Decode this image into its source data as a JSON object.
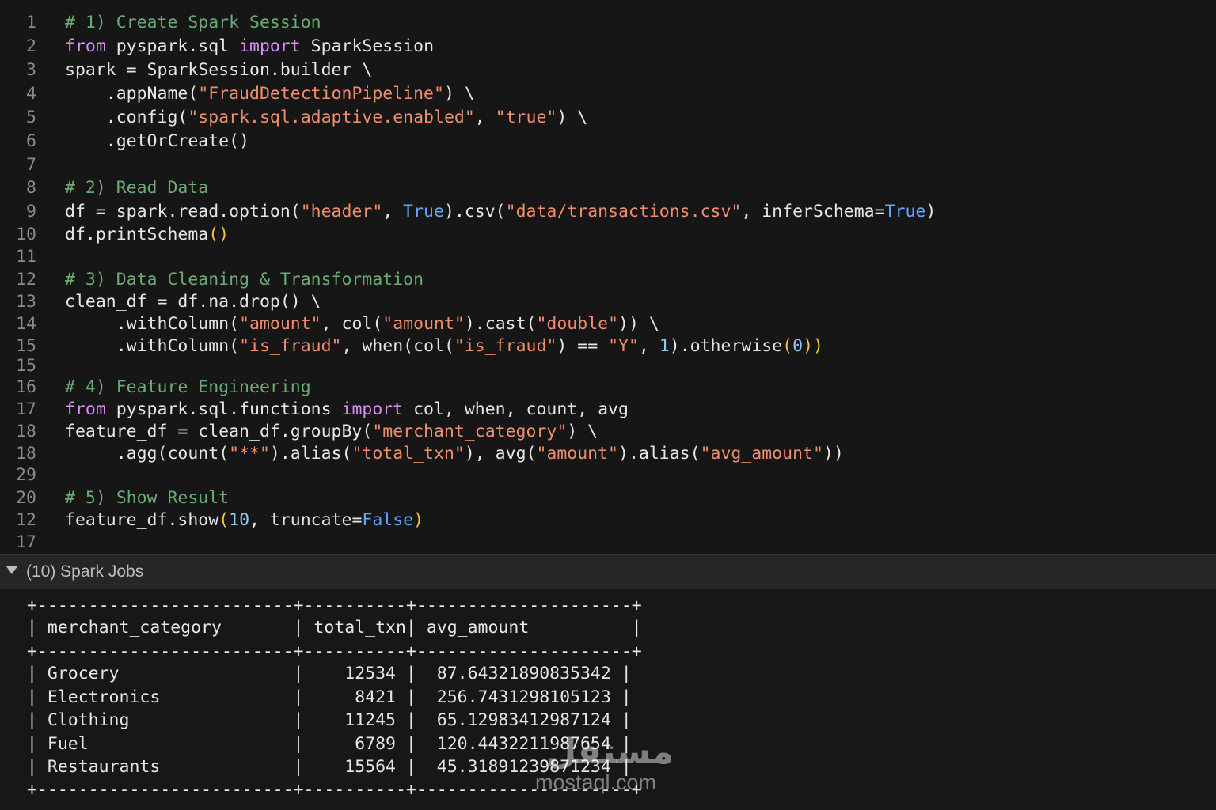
{
  "editor": {
    "lines": [
      {
        "num": "1",
        "tokens": [
          [
            "# 1) Create Spark Session",
            "comment"
          ]
        ]
      },
      {
        "num": "2",
        "tokens": [
          [
            "from",
            "keyword"
          ],
          [
            " pyspark.sql ",
            "default"
          ],
          [
            "import",
            "keyword"
          ],
          [
            " SparkSession",
            "default"
          ]
        ]
      },
      {
        "num": "3",
        "tokens": [
          [
            "spark = SparkSession.builder \\",
            "default"
          ]
        ]
      },
      {
        "num": "4",
        "tokens": [
          [
            "    .appName(",
            "default"
          ],
          [
            "\"FraudDetectionPipeline\"",
            "string"
          ],
          [
            ") \\",
            "default"
          ]
        ]
      },
      {
        "num": "5",
        "tokens": [
          [
            "    .config(",
            "default"
          ],
          [
            "\"spark.sql.adaptive.enabled\"",
            "string"
          ],
          [
            ", ",
            "default"
          ],
          [
            "\"true\"",
            "string"
          ],
          [
            ") \\",
            "default"
          ]
        ]
      },
      {
        "num": "6",
        "tokens": [
          [
            "    .getOrCreate()",
            "default"
          ]
        ]
      },
      {
        "num": "7",
        "tokens": []
      },
      {
        "num": "8",
        "tokens": [
          [
            "# 2) Read Data",
            "comment"
          ]
        ]
      },
      {
        "num": "9",
        "tokens": [
          [
            "df = spark.read.option(",
            "default"
          ],
          [
            "\"header\"",
            "string"
          ],
          [
            ", ",
            "default"
          ],
          [
            "True",
            "const"
          ],
          [
            ").csv(",
            "default"
          ],
          [
            "\"data/transactions.csv\"",
            "string"
          ],
          [
            ", inferSchema=",
            "default"
          ],
          [
            "True",
            "const"
          ],
          [
            ")",
            "default"
          ]
        ]
      },
      {
        "num": "10",
        "tokens": [
          [
            "df.printSchema",
            "default"
          ],
          [
            "()",
            "paren"
          ]
        ]
      },
      {
        "num": "11",
        "tokens": []
      },
      {
        "num": "12",
        "tokens": [
          [
            "# 3) Data Cleaning & Transformation",
            "comment"
          ]
        ]
      },
      {
        "num": "13",
        "tokens": [
          [
            "clean_df = df.na.drop() \\",
            "default"
          ]
        ]
      },
      {
        "num": "14",
        "tokens": [
          [
            "     .withColumn(",
            "default"
          ],
          [
            "\"amount\"",
            "string"
          ],
          [
            ", col(",
            "default"
          ],
          [
            "\"amount\"",
            "string"
          ],
          [
            ").cast(",
            "default"
          ],
          [
            "\"double\"",
            "string"
          ],
          [
            ")) \\",
            "default"
          ]
        ]
      },
      {
        "num": "15",
        "tokens": [
          [
            "     .withColumn(",
            "default"
          ],
          [
            "\"is_fraud\"",
            "string"
          ],
          [
            ", when(col(",
            "default"
          ],
          [
            "\"is_fraud\"",
            "string"
          ],
          [
            ") == ",
            "default"
          ],
          [
            "\"Y\"",
            "string"
          ],
          [
            ", ",
            "default"
          ],
          [
            "1",
            "number"
          ],
          [
            ").otherwise",
            "default"
          ],
          [
            "(",
            "paren"
          ],
          [
            "0",
            "number"
          ],
          [
            "))",
            "paren"
          ]
        ]
      },
      {
        "num": "15",
        "tokens": []
      },
      {
        "num": "16",
        "tokens": [
          [
            "# 4) Feature Engineering",
            "comment"
          ]
        ]
      },
      {
        "num": "17",
        "tokens": [
          [
            "from",
            "keyword"
          ],
          [
            " pyspark.sql.functions ",
            "default"
          ],
          [
            "import",
            "keyword"
          ],
          [
            " col, when, count, avg",
            "default"
          ]
        ]
      },
      {
        "num": "18",
        "tokens": [
          [
            "feature_df = clean_df.groupBy(",
            "default"
          ],
          [
            "\"merchant_category\"",
            "string"
          ],
          [
            ") \\",
            "default"
          ]
        ]
      },
      {
        "num": "18",
        "tokens": [
          [
            "     .agg(count(",
            "default"
          ],
          [
            "\"**\"",
            "string"
          ],
          [
            ").alias(",
            "default"
          ],
          [
            "\"total_txn\"",
            "string"
          ],
          [
            "), avg(",
            "default"
          ],
          [
            "\"amount\"",
            "string"
          ],
          [
            ").alias(",
            "default"
          ],
          [
            "\"avg_amount\"",
            "string"
          ],
          [
            "))",
            "default"
          ]
        ]
      },
      {
        "num": "29",
        "tokens": []
      },
      {
        "num": "20",
        "tokens": [
          [
            "# 5) Show Result",
            "comment"
          ]
        ]
      },
      {
        "num": "12",
        "tokens": [
          [
            "feature_df.show",
            "default"
          ],
          [
            "(",
            "paren"
          ],
          [
            "10",
            "number"
          ],
          [
            ", truncate=",
            "default"
          ],
          [
            "False",
            "const"
          ],
          [
            ")",
            "paren"
          ]
        ]
      },
      {
        "num": "17",
        "tokens": []
      }
    ]
  },
  "jobs": {
    "label": "(10) Spark Jobs",
    "icon": "triangle-down-icon"
  },
  "output": {
    "lines": [
      "+-------------------------+----------+---------------------+",
      "| merchant_category       | total_txn| avg_amount          |",
      "+-------------------------+----------+---------------------+",
      "| Grocery                 |    12534 |  87.64321890835342 |",
      "| Electronics             |     8421 |  256.7431298105123 |",
      "| Clothing                |    11245 |  65.12983412987124 |",
      "| Fuel                    |     6789 |  120.4432211987654 |",
      "| Restaurants             |    15564 |  45.31891239871234 |",
      "+-------------------------+----------+---------------------+"
    ]
  },
  "watermark": {
    "arabic": "مستقل",
    "latin": "mostaql.com"
  },
  "colors": {
    "comment": "#6aab73",
    "keyword": "#d78ff0",
    "string": "#f08d6c",
    "const": "#66a4ff",
    "paren": "#f4c542",
    "number": "#8ec9f0",
    "default": "#e6e6e6"
  }
}
